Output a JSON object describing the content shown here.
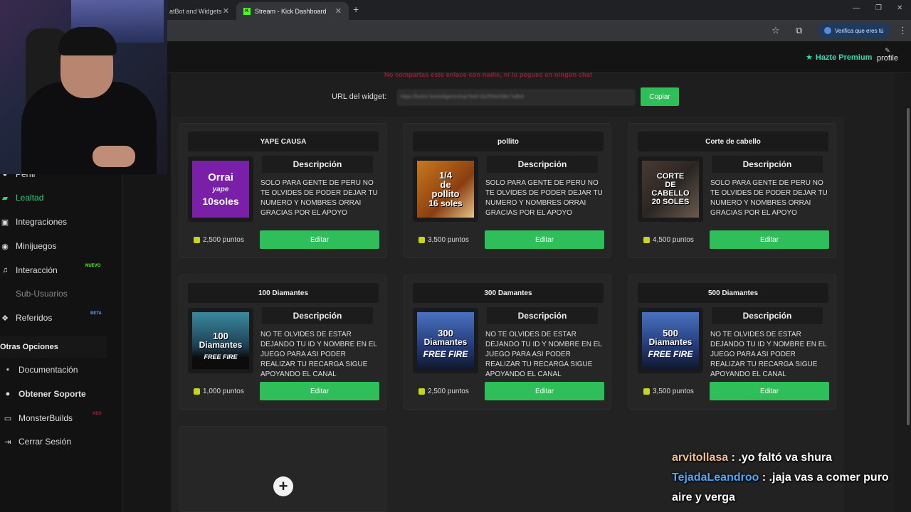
{
  "browser": {
    "tabs": [
      {
        "label": "atBot and Widgets"
      },
      {
        "label": "Stream - Kick Dashboard",
        "favicon": "K"
      }
    ],
    "verify_label": "Verifica que eres tú"
  },
  "header": {
    "premium_label": "Hazte Premium",
    "profile_label": "profile"
  },
  "sidebar": {
    "items": [
      {
        "label": "Perfil",
        "icon": "user-icon"
      },
      {
        "label": "Lealtad",
        "icon": "loyalty-icon",
        "active": true
      },
      {
        "label": "Integraciones",
        "icon": "puzzle-icon"
      },
      {
        "label": "Minijuegos",
        "icon": "gamepad-icon"
      },
      {
        "label": "Interacción",
        "icon": "music-icon",
        "badge": "NUEVO"
      },
      {
        "label": "Sub-Usuarios",
        "icon": "users-icon",
        "muted": true
      },
      {
        "label": "Referidos",
        "icon": "group-icon",
        "badge": "BETA"
      }
    ],
    "other_heading": "Otras Opciones",
    "other_items": [
      {
        "label": "Documentación",
        "icon": "doc-icon"
      },
      {
        "label": "Obtener Soporte",
        "icon": "support-icon"
      },
      {
        "label": "MonsterBuilds",
        "icon": "monitor-icon",
        "badge": "ADS"
      },
      {
        "label": "Cerrar Sesión",
        "icon": "logout-icon"
      }
    ]
  },
  "widget": {
    "warning": "No compartas este enlace con nadie, ni lo pegues en ningún chat",
    "url_label": "URL del widget:",
    "url_value": "https://botrix.live/widgets/shop?bid=1b2f3f4e5d6c7a8b9",
    "copy_label": "Copiar"
  },
  "cards": [
    {
      "title": "YAPE CAUSA",
      "desc_header": "Descripción",
      "description": "SOLO PARA GENTE DE PERU NO TE OLVIDES DE PODER DEJAR TU NUMERO Y NOMBRES ORRAI GRACIAS POR EL APOYO",
      "points": "2,500 puntos",
      "edit_label": "Editar",
      "img": [
        "Orrai",
        "yape",
        "10soles"
      ]
    },
    {
      "title": "pollito",
      "desc_header": "Descripción",
      "description": "SOLO PARA GENTE DE PERU NO TE OLVIDES DE PODER DEJAR TU NUMERO Y NOMBRES ORRAI GRACIAS POR EL APOYO",
      "points": "3,500 puntos",
      "edit_label": "Editar",
      "img": [
        "1/4",
        "de",
        "pollito",
        "16 soles"
      ]
    },
    {
      "title": "Corte de cabello",
      "desc_header": "Descripción",
      "description": "SOLO PARA GENTE DE PERU NO TE OLVIDES DE PODER DEJAR TU NUMERO Y NOMBRES ORRAI GRACIAS POR EL APOYO",
      "points": "4,500 puntos",
      "edit_label": "Editar",
      "img": [
        "CORTE",
        "DE",
        "CABELLO",
        "20 SOLES"
      ]
    },
    {
      "title": "100 Diamantes",
      "desc_header": "Descripción",
      "description": "NO TE OLVIDES DE ESTAR DEJANDO TU ID Y NOMBRE EN EL JUEGO PARA ASI PODER REALIZAR TU RECARGA SIGUE APOYANDO EL CANAL",
      "points": "1,000 puntos",
      "edit_label": "Editar",
      "img": [
        "100",
        "Diamantes",
        "FREE FIRE"
      ]
    },
    {
      "title": "300 Damantes",
      "desc_header": "Descripción",
      "description": "NO TE OLVIDES DE ESTAR DEJANDO TU ID Y NOMBRE EN EL JUEGO PARA ASI PODER REALIZAR TU RECARGA SIGUE APOYANDO EL CANAL",
      "points": "2,500 puntos",
      "edit_label": "Editar",
      "img": [
        "300",
        "Diamantes",
        "FREE FIRE"
      ]
    },
    {
      "title": "500 Diamantes",
      "desc_header": "Descripción",
      "description": "NO TE OLVIDES DE ESTAR DEJANDO TU ID Y NOMBRE EN EL JUEGO PARA ASI PODER REALIZAR TU RECARGA SIGUE APOYANDO EL CANAL",
      "points": "3,500 puntos",
      "edit_label": "Editar",
      "img": [
        "500",
        "Diamantes",
        "FREE FIRE"
      ]
    }
  ],
  "chat": [
    {
      "user": "arvitollasa",
      "message": ".yo faltó va shura"
    },
    {
      "user": "TejadaLeandroo",
      "message": ".jaja vas a comer puro aire y verga"
    }
  ],
  "colors": {
    "accent": "#2fbf5a",
    "premium": "#2fe0b0",
    "warning": "#b0203a"
  }
}
